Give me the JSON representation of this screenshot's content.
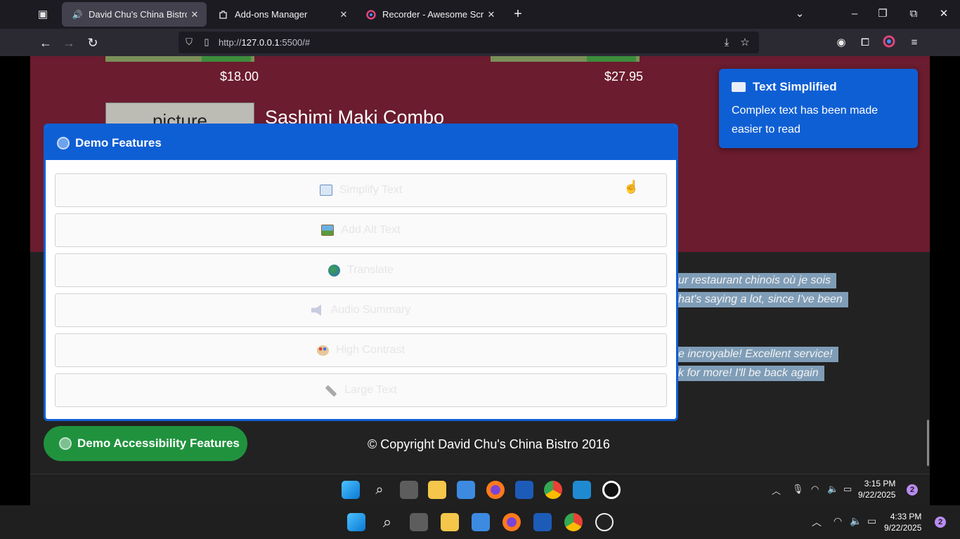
{
  "browser": {
    "tabs": [
      {
        "label": "David Chu's China Bistro",
        "icon": "speaker-icon"
      },
      {
        "label": "Add-ons Manager",
        "icon": "puzzle-icon"
      },
      {
        "label": "Recorder - Awesome Screenshot",
        "icon": "recorder-icon"
      }
    ],
    "url_prefix": "http://",
    "url_host": "127.0.0.1",
    "url_rest": ":5500/#"
  },
  "page": {
    "price_left": "$18.00",
    "price_right": "$27.95",
    "picture_label": "picture",
    "dish_name": "Sashimi Maki Combo",
    "review_lines": [
      "ur restaurant chinois où je sois",
      "hat's saying a lot, since I've been",
      "e incroyable! Excellent service!",
      "k for more! I'll be back again"
    ],
    "copyright": "© Copyright David Chu's China Bistro 2016"
  },
  "toast": {
    "title": "Text Simplified",
    "message_line1": "Complex text has been made",
    "message_line2": "easier to read"
  },
  "demo_panel": {
    "title": "Demo Features",
    "features": [
      {
        "label": "Simplify Text",
        "icon": "book-icon"
      },
      {
        "label": "Add Alt Text",
        "icon": "picture-icon"
      },
      {
        "label": "Translate",
        "icon": "globe-icon"
      },
      {
        "label": "Audio Summary",
        "icon": "speaker-icon"
      },
      {
        "label": "High Contrast",
        "icon": "palette-icon"
      },
      {
        "label": "Large Text",
        "icon": "ruler-icon"
      }
    ],
    "toggle_label": "Demo Accessibility Features"
  },
  "inner_taskbar": {
    "time": "3:15 PM",
    "date": "9/22/2025",
    "badge": "2"
  },
  "taskbar": {
    "time": "4:33 PM",
    "date": "9/22/2025",
    "badge": "2"
  },
  "colors": {
    "maroon": "#6b1c2e",
    "accent_blue": "#0f5fd4",
    "accent_green": "#20923e"
  }
}
